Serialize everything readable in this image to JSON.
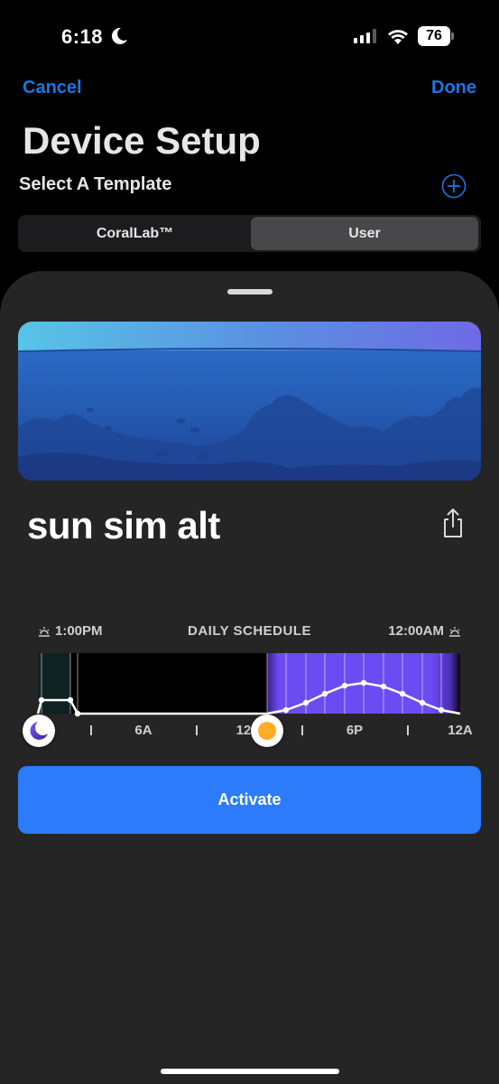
{
  "status_bar": {
    "time": "6:18",
    "battery": "76"
  },
  "nav": {
    "cancel_label": "Cancel",
    "done_label": "Done"
  },
  "page_title": "Device Setup",
  "section_label": "Select A Template",
  "segments": [
    {
      "label": "CoralLab™",
      "selected": false
    },
    {
      "label": "User",
      "selected": true
    }
  ],
  "template": {
    "name": "sun sim alt"
  },
  "schedule": {
    "title": "DAILY SCHEDULE",
    "start_time": "1:00PM",
    "end_time": "12:00AM",
    "tick_labels": [
      "6A",
      "12",
      "6P",
      "12A"
    ]
  },
  "activate_label": "Activate",
  "colors": {
    "accent": "#1877e6",
    "button": "#2b7bfa",
    "sheet": "#252525",
    "schedule_purple": "#6a48f0",
    "sun": "#ffad24"
  }
}
